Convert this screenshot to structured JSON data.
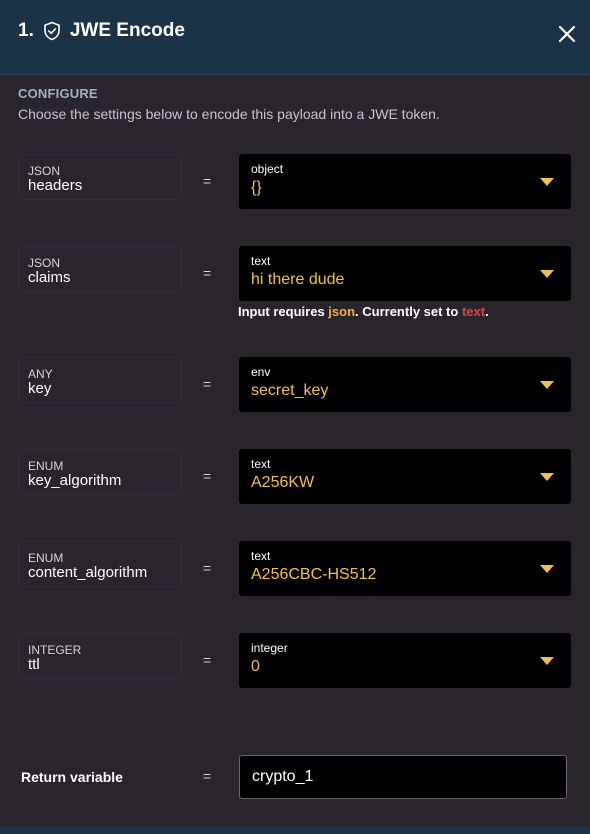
{
  "header": {
    "step": "1.",
    "title": "JWE Encode"
  },
  "configure": {
    "title": "CONFIGURE",
    "description": "Choose the settings below to encode this payload into a JWE token."
  },
  "params": [
    {
      "type_label": "JSON",
      "name": "headers",
      "value_type": "object",
      "value": "{}"
    },
    {
      "type_label": "JSON",
      "name": "claims",
      "value_type": "text",
      "value": "hi there dude"
    },
    {
      "type_label": "ANY",
      "name": "key",
      "value_type": "env",
      "value": "secret_key"
    },
    {
      "type_label": "ENUM",
      "name": "key_algorithm",
      "value_type": "text",
      "value": "A256KW"
    },
    {
      "type_label": "ENUM",
      "name": "content_algorithm",
      "value_type": "text",
      "value": "A256CBC-HS512"
    },
    {
      "type_label": "INTEGER",
      "name": "ttl",
      "value_type": "integer",
      "value": "0"
    }
  ],
  "equals": "=",
  "claims_hint": {
    "prefix": "Input requires ",
    "required": "json",
    "middle": ". Currently set to ",
    "current": "text",
    "suffix": "."
  },
  "return_variable": {
    "label": "Return variable",
    "value": "crypto_1"
  },
  "colors": {
    "header_bg": "#1b3346",
    "panel_bg": "#2a242d",
    "value_text": "#f3c14b",
    "required_type": "#f3b043",
    "current_type": "#e0454c"
  },
  "icons": {
    "title_icon": "shield-check-icon",
    "close": "close-icon",
    "dropdown": "caret-down-icon"
  }
}
